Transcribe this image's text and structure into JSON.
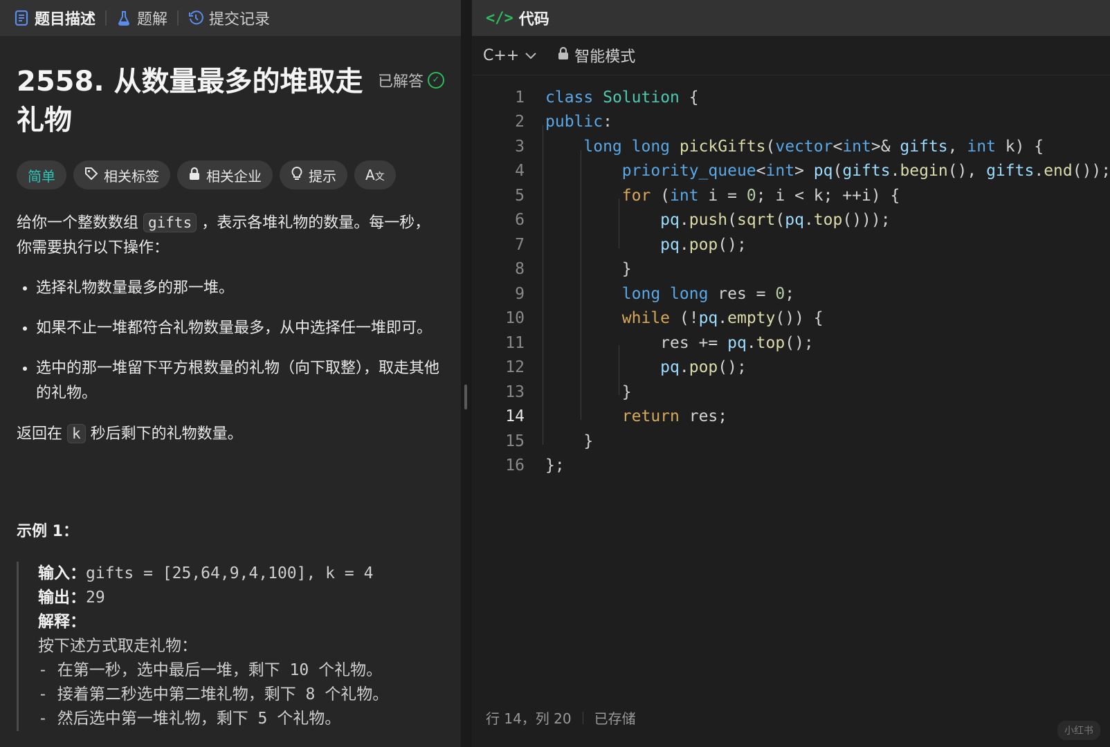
{
  "left_tabs": [
    {
      "label": "题目描述",
      "icon": "document-icon"
    },
    {
      "label": "题解",
      "icon": "flask-icon"
    },
    {
      "label": "提交记录",
      "icon": "history-icon"
    }
  ],
  "problem": {
    "title_line1": "2558. 从数量最多的堆取走",
    "title_line2": "礼物",
    "status": "已解答",
    "chips": [
      "简单",
      "相关标签",
      "相关企业",
      "提示",
      "A文"
    ],
    "intro_pre": "给你一个整数数组 ",
    "intro_code": "gifts",
    "intro_post": " ，表示各堆礼物的数量。每一秒，你需要执行以下操作：",
    "bullets": [
      "选择礼物数量最多的那一堆。",
      "如果不止一堆都符合礼物数量最多，从中选择任一堆即可。",
      "选中的那一堆留下平方根数量的礼物（向下取整），取走其他的礼物。"
    ],
    "return_pre": "返回在 ",
    "return_code": "k",
    "return_post": " 秒后剩下的礼物数量。",
    "example_title": "示例 1：",
    "ex_input_label": "输入：",
    "ex_input": "gifts = [25,64,9,4,100], k = 4",
    "ex_output_label": "输出：",
    "ex_output": "29",
    "ex_explain_label": "解释：",
    "ex_lines": [
      "按下述方式取走礼物：",
      "- 在第一秒，选中最后一堆，剩下 10 个礼物。",
      "- 接着第二秒选中第二堆礼物，剩下 8 个礼物。",
      "- 然后选中第一堆礼物，剩下 5 个礼物。"
    ]
  },
  "editor": {
    "header": "代码",
    "language": "C++",
    "mode": "智能模式",
    "current_line": 14,
    "lines": [
      "class Solution {",
      "public:",
      "    long long pickGifts(vector<int>& gifts, int k) {",
      "        priority_queue<int> pq(gifts.begin(), gifts.end());",
      "        for (int i = 0; i < k; ++i) {",
      "            pq.push(sqrt(pq.top()));",
      "            pq.pop();",
      "        }",
      "        long long res = 0;",
      "        while (!pq.empty()) {",
      "            res += pq.top();",
      "            pq.pop();",
      "        }",
      "        return res;",
      "    }",
      "};"
    ],
    "status_position": "行 14，列 20",
    "status_saved": "已存储"
  },
  "watermark": "小红书"
}
